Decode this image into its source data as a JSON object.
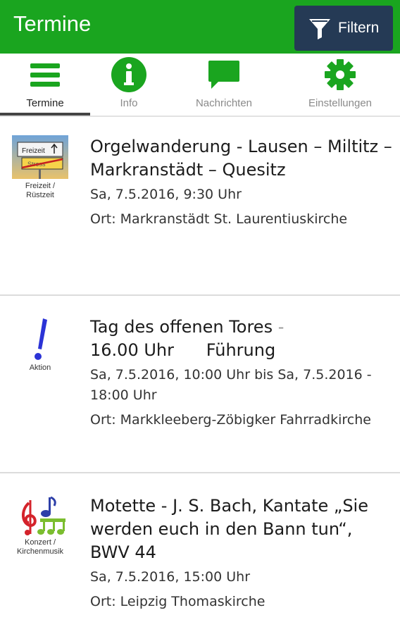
{
  "appbar": {
    "title": "Termine",
    "filter_label": "Filtern",
    "bg_color": "#1aa51f",
    "filter_bg": "#253a55"
  },
  "tabs": [
    {
      "label": "Termine",
      "icon": "menu-icon",
      "active": true
    },
    {
      "label": "Info",
      "icon": "info-icon",
      "active": false
    },
    {
      "label": "Nachrichten",
      "icon": "chat-icon",
      "active": false
    },
    {
      "label": "Einstellungen",
      "icon": "gear-icon",
      "active": false
    }
  ],
  "events": [
    {
      "category": "Freizeit / Rüstzeit",
      "category_line1": "Freizeit /",
      "category_line2": "Rüstzeit",
      "category_sign_top": "Freizeit",
      "category_sign_bottom": "Stress",
      "icon": "freizeit-sign-icon",
      "title": "Orgelwanderung - Lausen – Miltitz – Markranstädt – Quesitz",
      "date": "Sa, 7.5.2016, 9:30 Uhr",
      "location": "Ort: Markranstädt St. Laurentiuskirche"
    },
    {
      "category": "Aktion",
      "category_line1": "Aktion",
      "icon": "exclamation-icon",
      "title_main": "Tag des offenen Tores",
      "title_sep": " - ",
      "title_rest": "16.00 Uhr      Führung",
      "date": "Sa, 7.5.2016, 10:00 Uhr bis Sa, 7.5.2016 - 18:00 Uhr",
      "location": "Ort: Markkleeberg-Zöbigker Fahrradkirche"
    },
    {
      "category": "Konzert / Kirchenmusik",
      "category_line1": "Konzert /",
      "category_line2": "Kirchenmusik",
      "icon": "music-notes-icon",
      "title": "Motette - J. S. Bach, Kantate „Sie werden euch in den Bann tun“, BWV 44",
      "date": "Sa, 7.5.2016, 15:00 Uhr",
      "location": "Ort: Leipzig Thomaskirche"
    }
  ],
  "colors": {
    "accent_green": "#1aa51f",
    "exclamation_blue": "#2b33d6",
    "music_red": "#d4232b",
    "music_green": "#7bbd2f",
    "music_blue": "#2d3fa8"
  }
}
